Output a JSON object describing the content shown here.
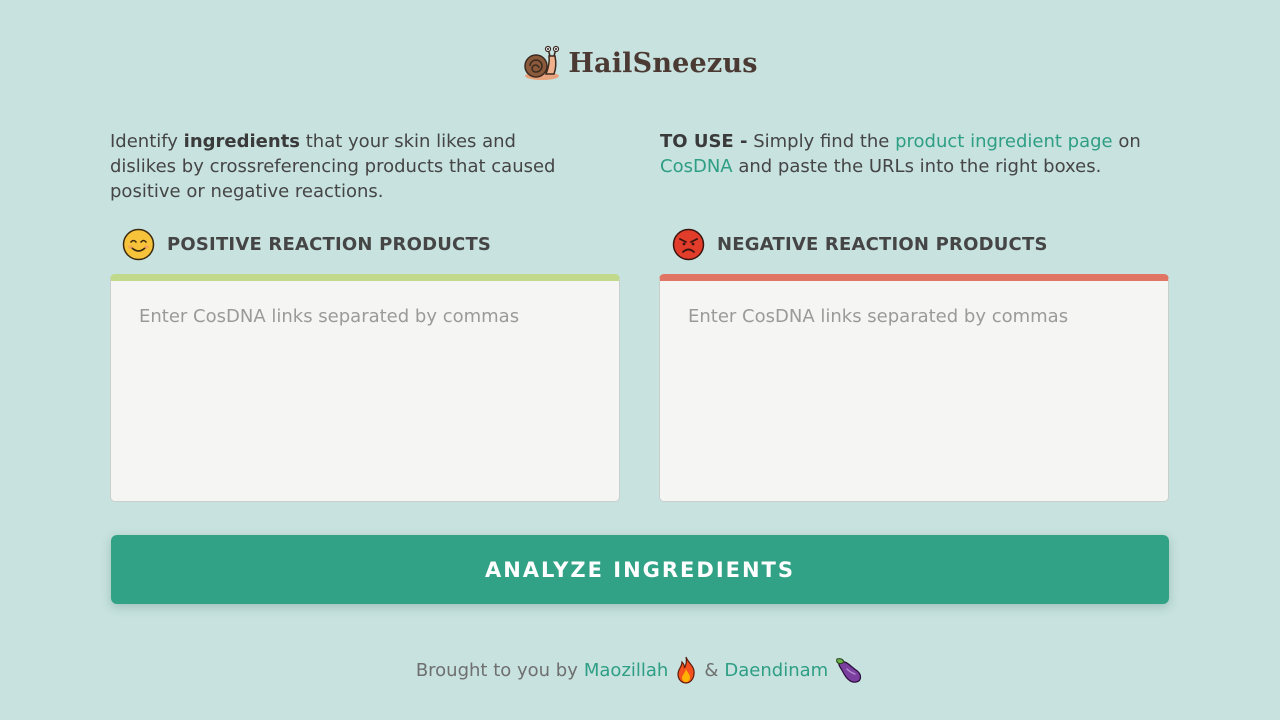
{
  "brand": {
    "title": "HailSneezus",
    "logo_icon": "snail-icon"
  },
  "intro_left": {
    "prefix": "Identify ",
    "bold": "ingredients",
    "suffix": " that your skin likes and dislikes by crossreferencing products that caused positive or negative reactions."
  },
  "intro_right": {
    "label": "TO USE -",
    "text1": " Simply find the ",
    "link1": "product ingredient page",
    "text2": " on ",
    "link2": "CosDNA",
    "text3": " and paste the URLs into the right boxes."
  },
  "positive": {
    "label": "POSITIVE REACTION PRODUCTS",
    "icon": "smiling-face-icon",
    "placeholder": "Enter CosDNA links separated by commas",
    "value": ""
  },
  "negative": {
    "label": "NEGATIVE REACTION PRODUCTS",
    "icon": "angry-face-icon",
    "placeholder": "Enter CosDNA links separated by commas",
    "value": ""
  },
  "analyze_button": {
    "label": "ANALYZE INGREDIENTS"
  },
  "footer": {
    "prefix": "Brought to you by",
    "author1": "Maozillah",
    "author1_icon": "fire-icon",
    "separator": "&",
    "author2": "Daendinam",
    "author2_icon": "eggplant-icon"
  },
  "colors": {
    "background": "#c7e2df",
    "accent": "#31a285",
    "positive_bar": "#c0d98a",
    "negative_bar": "#e07563"
  }
}
